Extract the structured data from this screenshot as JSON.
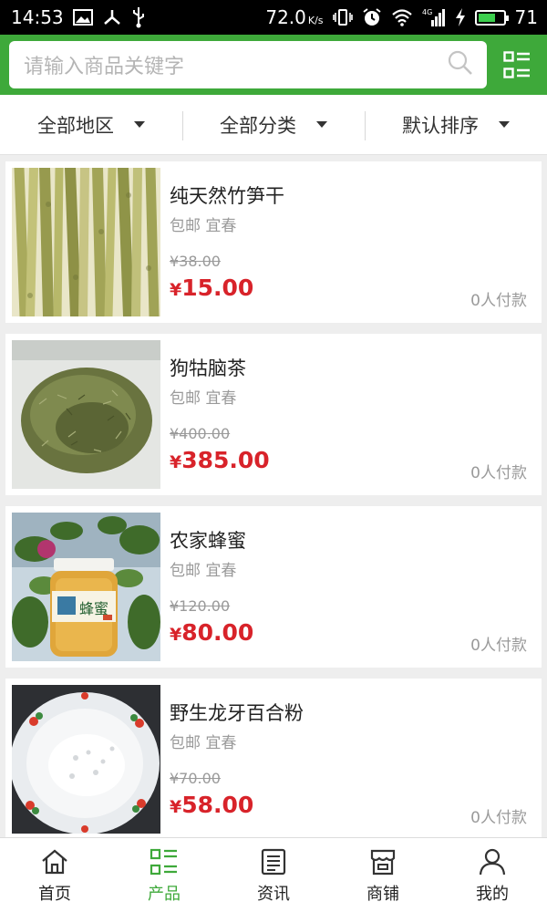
{
  "status_bar": {
    "time": "14:53",
    "speed": "72.0",
    "speed_unit": "K/s",
    "network": "4G",
    "battery": "71",
    "battery_level": 0.71,
    "icons": [
      "image-icon",
      "usb-debug-icon",
      "usb-icon",
      "vibrate-icon",
      "alarm-icon",
      "wifi-icon",
      "signal-icon",
      "charging-icon",
      "battery-icon"
    ]
  },
  "search": {
    "placeholder": "请输入商品关键字"
  },
  "filters": [
    {
      "label": "全部地区"
    },
    {
      "label": "全部分类"
    },
    {
      "label": "默认排序"
    }
  ],
  "products": [
    {
      "name": "纯天然竹笋干",
      "tags": "包邮 宜春",
      "old_price": "¥38.00",
      "currency": "¥",
      "price": "15.00",
      "paid": "0人付款",
      "image": "bamboo-shoots"
    },
    {
      "name": "狗牯脑茶",
      "tags": "包邮 宜春",
      "old_price": "¥400.00",
      "currency": "¥",
      "price": "385.00",
      "paid": "0人付款",
      "image": "tea-leaves"
    },
    {
      "name": "农家蜂蜜",
      "tags": "包邮 宜春",
      "old_price": "¥120.00",
      "currency": "¥",
      "price": "80.00",
      "paid": "0人付款",
      "image": "honey-jar",
      "image_text": "蜂蜜"
    },
    {
      "name": "野生龙牙百合粉",
      "tags": "包邮 宜春",
      "old_price": "¥70.00",
      "currency": "¥",
      "price": "58.00",
      "paid": "0人付款",
      "image": "lily-powder"
    }
  ],
  "bottom_nav": [
    {
      "label": "首页",
      "icon": "home-icon",
      "active": false
    },
    {
      "label": "产品",
      "icon": "list-icon",
      "active": true
    },
    {
      "label": "资讯",
      "icon": "news-icon",
      "active": false
    },
    {
      "label": "商铺",
      "icon": "shop-icon",
      "active": false
    },
    {
      "label": "我的",
      "icon": "user-icon",
      "active": false
    }
  ],
  "colors": {
    "brand": "#3ea93a",
    "price": "#d8232a",
    "muted": "#9a9a9a"
  }
}
